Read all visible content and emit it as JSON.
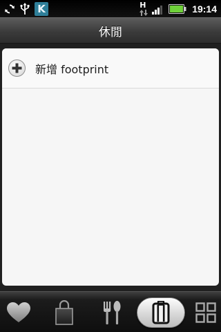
{
  "status_bar": {
    "icons": [
      "sync-icon",
      "usb-icon",
      "k-app-icon",
      "hspa-data-icon",
      "signal-icon",
      "battery-icon"
    ],
    "k_label": "K",
    "network_label": "H",
    "time": "19:14"
  },
  "title_bar": {
    "title": "休閒"
  },
  "list": {
    "add_item_label": "新增 footprint"
  },
  "tabs": [
    {
      "name": "favorites",
      "icon": "heart-icon",
      "active": false
    },
    {
      "name": "shopping",
      "icon": "shopping-bag-icon",
      "active": false
    },
    {
      "name": "dining",
      "icon": "fork-spoon-icon",
      "active": false
    },
    {
      "name": "leisure",
      "icon": "luggage-icon",
      "active": true
    },
    {
      "name": "all",
      "icon": "grid-icon",
      "active": false
    }
  ],
  "colors": {
    "accent_battery": "#6fd13a",
    "k_icon_bg": "#2f7f99",
    "panel_bg": "#f6f6f6"
  }
}
